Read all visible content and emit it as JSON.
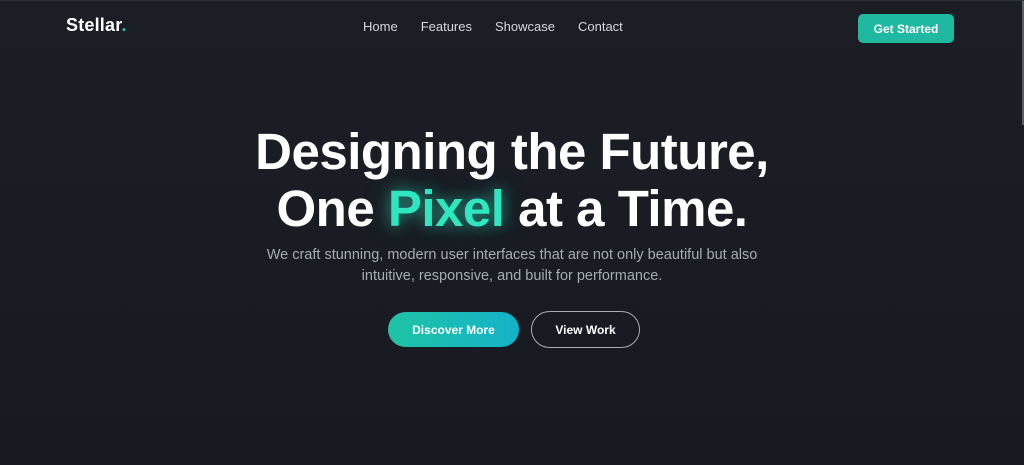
{
  "brand": {
    "name": "Stellar",
    "dot": "."
  },
  "nav": {
    "links": [
      "Home",
      "Features",
      "Showcase",
      "Contact"
    ],
    "cta": "Get Started"
  },
  "hero": {
    "line1": "Designing the Future,",
    "line2_before": "One",
    "line2_accent": "Pixel",
    "line2_after": "at a Time.",
    "subtext": "We craft stunning, modern user interfaces that are not only beautiful but also intuitive, responsive, and built for performance.",
    "primary_button": "Discover More",
    "secondary_button": "View Work"
  },
  "colors": {
    "accent": "#2ee6bf",
    "button_teal": "#1fb8a1",
    "background": "#1a1d24"
  }
}
